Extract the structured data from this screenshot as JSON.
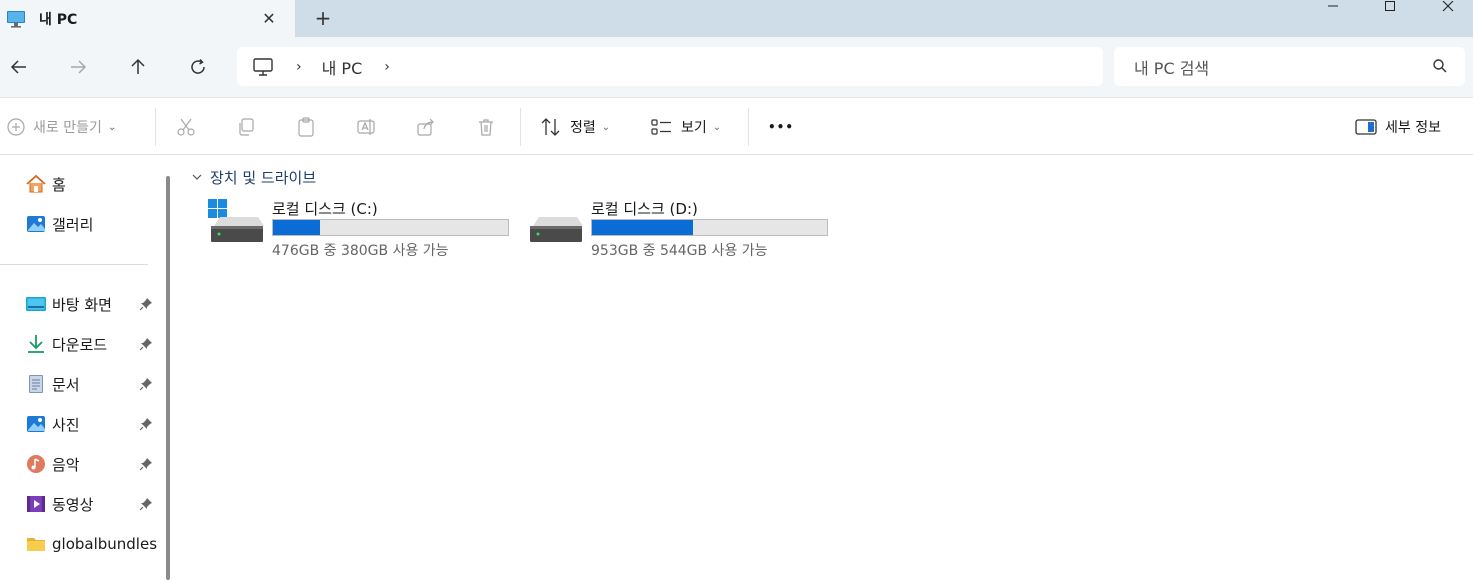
{
  "window": {
    "tab_title": "내 PC",
    "new_tab": "+",
    "close_tab": "✕"
  },
  "address": {
    "crumb": "내 PC",
    "separator": "›",
    "search_placeholder": "내 PC 검색"
  },
  "toolbar": {
    "new_label": "새로 만들기",
    "sort_label": "정렬",
    "view_label": "보기",
    "more_label": "•••",
    "details_label": "세부 정보",
    "caret": "⌄"
  },
  "sidebar": {
    "top": [
      {
        "label": "홈",
        "icon": "home-icon"
      },
      {
        "label": "갤러리",
        "icon": "gallery-icon"
      }
    ],
    "pinned": [
      {
        "label": "바탕 화면",
        "icon": "desktop-folder-icon"
      },
      {
        "label": "다운로드",
        "icon": "download-icon"
      },
      {
        "label": "문서",
        "icon": "document-icon"
      },
      {
        "label": "사진",
        "icon": "pictures-icon"
      },
      {
        "label": "음악",
        "icon": "music-icon"
      },
      {
        "label": "동영상",
        "icon": "videos-icon"
      }
    ],
    "folders": [
      {
        "label": "globalbundles",
        "icon": "folder-icon"
      }
    ]
  },
  "content": {
    "group_label": "장치 및 드라이브",
    "drives": [
      {
        "name": "로컬 디스크 (C:)",
        "free_text": "476GB 중 380GB 사용 가능",
        "used_fraction": 0.202,
        "system": true
      },
      {
        "name": "로컬 디스크 (D:)",
        "free_text": "953GB 중 544GB 사용 가능",
        "used_fraction": 0.429,
        "system": false
      }
    ]
  },
  "colors": {
    "accent": "#0a6cd4",
    "titlebar": "#cfdde9",
    "nav_bg": "#f3f6f9"
  }
}
